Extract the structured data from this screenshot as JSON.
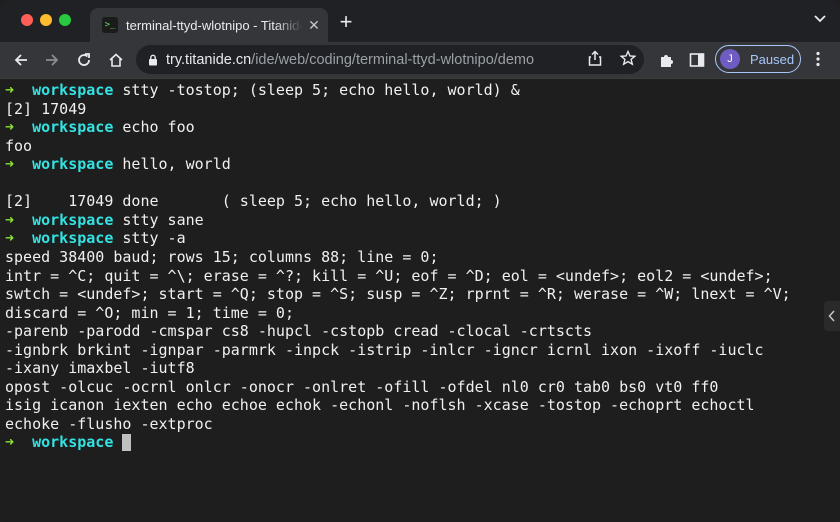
{
  "browser": {
    "tab_title": "terminal-ttyd-wlotnipo - Titanide",
    "tab_favicon_text": ">_",
    "url_host": "try.titanide.cn",
    "url_path": "/ide/web/coding/terminal-ttyd-wlotnipo/demo",
    "profile_initial": "J",
    "profile_status": "Paused"
  },
  "terminal": {
    "prompt_arrow": "➜",
    "prompt_dir": "workspace",
    "lines": [
      {
        "type": "prompt",
        "cmd": " stty -tostop; (sleep 5; echo hello, world) &"
      },
      {
        "type": "out",
        "text": "[2] 17049"
      },
      {
        "type": "prompt",
        "cmd": " echo foo"
      },
      {
        "type": "out",
        "text": "foo"
      },
      {
        "type": "prompt",
        "cmd": " hello, world"
      },
      {
        "type": "out",
        "text": ""
      },
      {
        "type": "out",
        "text": "[2]    17049 done       ( sleep 5; echo hello, world; )"
      },
      {
        "type": "prompt",
        "cmd": " stty sane"
      },
      {
        "type": "prompt",
        "cmd": " stty -a"
      },
      {
        "type": "out",
        "text": "speed 38400 baud; rows 15; columns 88; line = 0;"
      },
      {
        "type": "out",
        "text": "intr = ^C; quit = ^\\; erase = ^?; kill = ^U; eof = ^D; eol = <undef>; eol2 = <undef>;"
      },
      {
        "type": "out",
        "text": "swtch = <undef>; start = ^Q; stop = ^S; susp = ^Z; rprnt = ^R; werase = ^W; lnext = ^V;"
      },
      {
        "type": "out",
        "text": "discard = ^O; min = 1; time = 0;"
      },
      {
        "type": "out",
        "text": "-parenb -parodd -cmspar cs8 -hupcl -cstopb cread -clocal -crtscts"
      },
      {
        "type": "out",
        "text": "-ignbrk brkint -ignpar -parmrk -inpck -istrip -inlcr -igncr icrnl ixon -ixoff -iuclc"
      },
      {
        "type": "out",
        "text": "-ixany imaxbel -iutf8"
      },
      {
        "type": "out",
        "text": "opost -olcuc -ocrnl onlcr -onocr -onlret -ofill -ofdel nl0 cr0 tab0 bs0 vt0 ff0"
      },
      {
        "type": "out",
        "text": "isig icanon iexten echo echoe echok -echonl -noflsh -xcase -tostop -echoprt echoctl"
      },
      {
        "type": "out",
        "text": "echoke -flusho -extproc"
      },
      {
        "type": "prompt",
        "cmd": " ",
        "cursor": true
      }
    ]
  },
  "colors": {
    "prompt_arrow": "#8ae234",
    "prompt_dir": "#34e2e2",
    "terminal_bg": "#1e1e1e",
    "terminal_fg": "#f0f0f0"
  }
}
